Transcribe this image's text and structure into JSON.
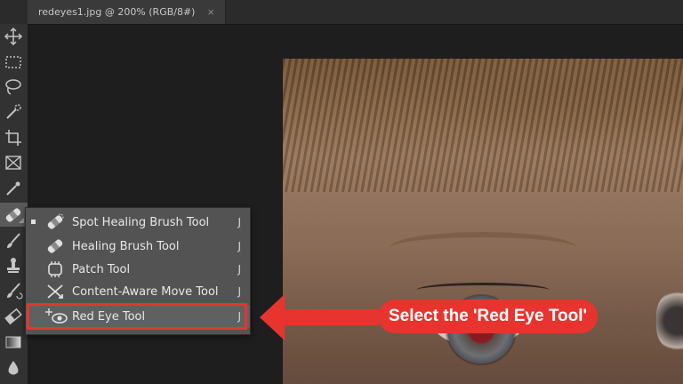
{
  "document_tab": {
    "title": "redeyes1.jpg @ 200% (RGB/8#)",
    "close_glyph": "×"
  },
  "toolbar": {
    "tools": [
      {
        "icon": "move-icon"
      },
      {
        "icon": "rectangular-marquee-icon"
      },
      {
        "icon": "lasso-icon"
      },
      {
        "icon": "quick-selection-icon"
      },
      {
        "icon": "crop-icon"
      },
      {
        "icon": "frame-icon"
      },
      {
        "icon": "eyedropper-icon"
      },
      {
        "icon": "spot-healing-brush-icon",
        "active": true
      },
      {
        "icon": "brush-icon"
      },
      {
        "icon": "clone-stamp-icon"
      },
      {
        "icon": "history-brush-icon"
      },
      {
        "icon": "eraser-icon"
      },
      {
        "icon": "gradient-icon"
      },
      {
        "icon": "blur-icon"
      }
    ]
  },
  "flyout": {
    "items": [
      {
        "label": "Spot Healing Brush Tool",
        "shortcut": "J",
        "icon": "spot-healing-brush-icon",
        "current": true
      },
      {
        "label": "Healing Brush Tool",
        "shortcut": "J",
        "icon": "healing-brush-icon"
      },
      {
        "label": "Patch Tool",
        "shortcut": "J",
        "icon": "patch-icon"
      },
      {
        "label": "Content-Aware Move Tool",
        "shortcut": "J",
        "icon": "content-aware-move-icon"
      },
      {
        "label": "Red Eye Tool",
        "shortcut": "J",
        "icon": "red-eye-icon",
        "highlighted": true
      }
    ]
  },
  "callout": {
    "text": "Select the 'Red Eye Tool'",
    "color": "#e8342f"
  },
  "colors": {
    "highlight": "#e8342f",
    "panel": "#535353",
    "toolbar": "#323232",
    "canvas": "#1e1e1e"
  }
}
